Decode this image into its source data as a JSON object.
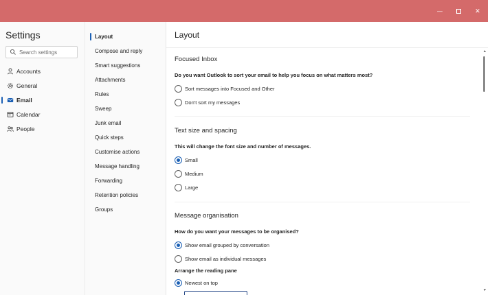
{
  "window": {
    "minimize_glyph": "—",
    "close_glyph": "✕"
  },
  "nav": {
    "title": "Settings",
    "search_placeholder": "Search settings",
    "items": [
      {
        "label": "Accounts",
        "icon": "person-icon"
      },
      {
        "label": "General",
        "icon": "gear-icon"
      },
      {
        "label": "Email",
        "icon": "mail-icon",
        "active": true
      },
      {
        "label": "Calendar",
        "icon": "calendar-icon"
      },
      {
        "label": "People",
        "icon": "people-icon"
      }
    ]
  },
  "subnav": {
    "items": [
      {
        "label": "Layout",
        "active": true
      },
      {
        "label": "Compose and reply"
      },
      {
        "label": "Smart suggestions"
      },
      {
        "label": "Attachments"
      },
      {
        "label": "Rules"
      },
      {
        "label": "Sweep"
      },
      {
        "label": "Junk email"
      },
      {
        "label": "Quick steps"
      },
      {
        "label": "Customise actions"
      },
      {
        "label": "Message handling"
      },
      {
        "label": "Forwarding"
      },
      {
        "label": "Retention policies"
      },
      {
        "label": "Groups"
      }
    ]
  },
  "main": {
    "title": "Layout",
    "focused_inbox": {
      "title": "Focused Inbox",
      "question": "Do you want Outlook to sort your email to help you focus on what matters most?",
      "options": [
        {
          "label": "Sort messages into Focused and Other",
          "checked": false
        },
        {
          "label": "Don't sort my messages",
          "checked": false
        }
      ]
    },
    "text_size": {
      "title": "Text size and spacing",
      "question": "This will change the font size and number of messages.",
      "options": [
        {
          "label": "Small",
          "checked": true
        },
        {
          "label": "Medium",
          "checked": false
        },
        {
          "label": "Large",
          "checked": false
        }
      ]
    },
    "organisation": {
      "title": "Message organisation",
      "question": "How do you want your messages to be organised?",
      "options": [
        {
          "label": "Show email grouped by conversation",
          "checked": true
        },
        {
          "label": "Show email as individual messages",
          "checked": false
        }
      ],
      "reading_pane_label": "Arrange the reading pane",
      "reading_pane_options": [
        {
          "label": "Newest on top",
          "checked": true
        }
      ]
    }
  },
  "colors": {
    "titlebar": "#d46a6a",
    "accent": "#1a5fb4"
  }
}
